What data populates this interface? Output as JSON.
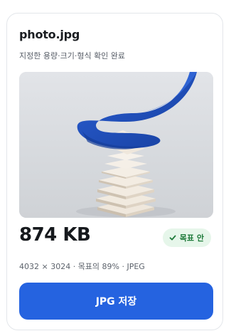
{
  "file": {
    "name": "photo.jpg",
    "status": "지정한 용량·크기·형식 확인 완료"
  },
  "preview": {
    "image_icon": "photo-preview-ribbon-stack"
  },
  "result": {
    "size": "874 KB",
    "badge_label": "목표 안",
    "badge_icon": "check-icon",
    "details": "4032 × 3024 · 목표의 89% · JPEG"
  },
  "actions": {
    "save_label": "JPG 저장"
  },
  "colors": {
    "accent": "#2563e0",
    "badge_bg": "#e6f6ea",
    "badge_text": "#1e7a3a",
    "ribbon": "#1f4fbf"
  }
}
